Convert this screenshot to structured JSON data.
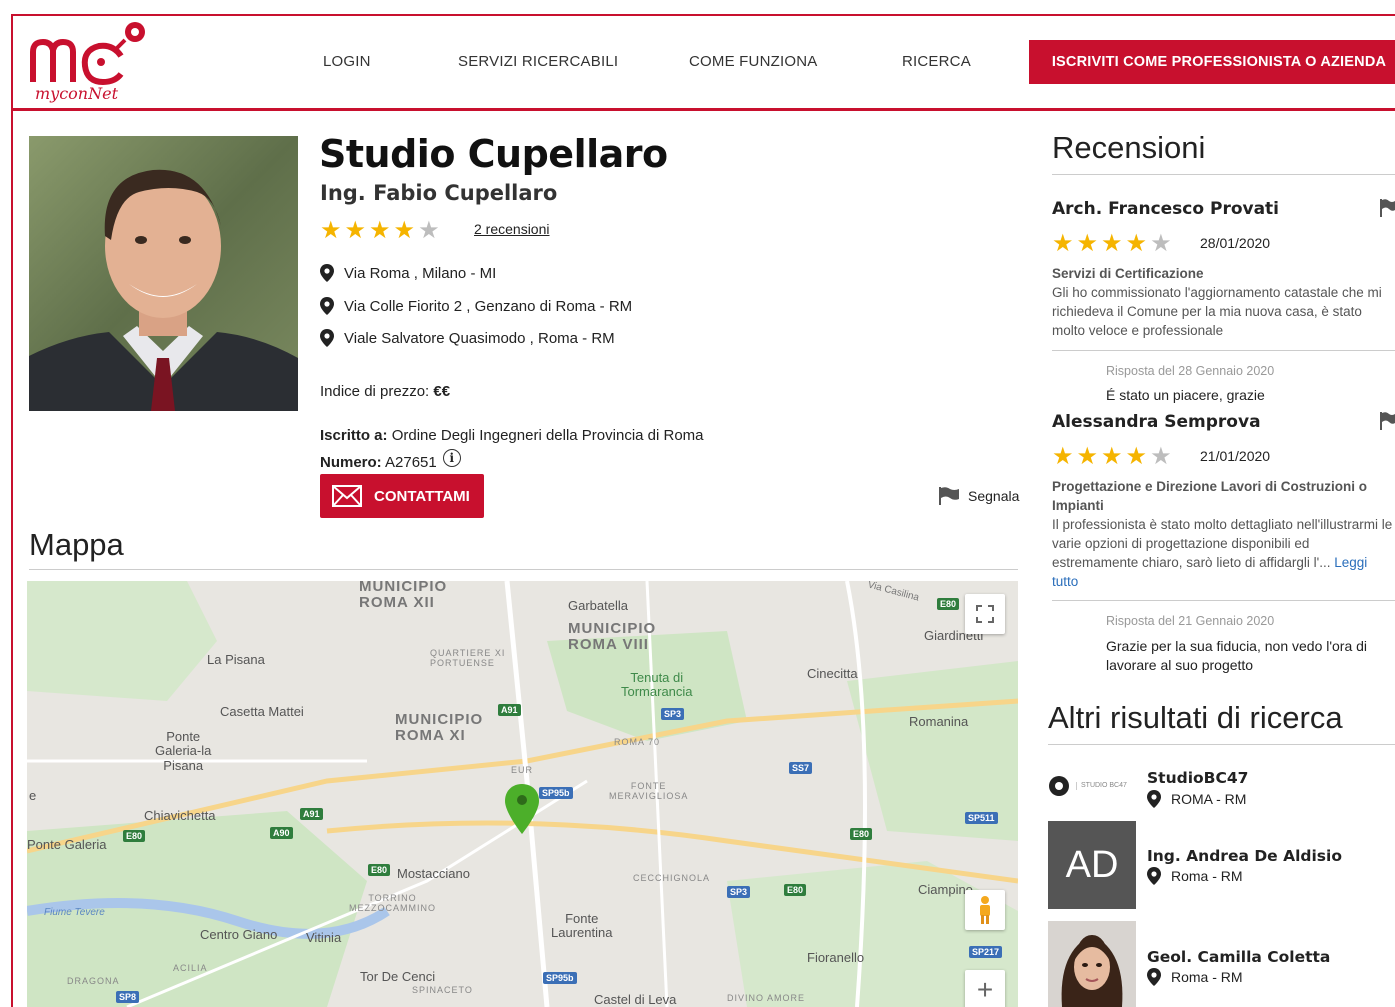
{
  "brand": {
    "name": "myconNet"
  },
  "nav": {
    "items": [
      "LOGIN",
      "SERVIZI RICERCABILI",
      "COME FUNZIONA",
      "RICERCA"
    ],
    "cta": "ISCRIVITI COME PROFESSIONISTA O AZIENDA"
  },
  "profile": {
    "studio": "Studio Cupellaro",
    "name": "Ing. Fabio Cupellaro",
    "rating": 4,
    "rating_max": 5,
    "reviews_link": "2 recensioni",
    "addresses": [
      "Via Roma , Milano - MI",
      "Via Colle Fiorito 2 , Genzano di Roma - RM",
      "Viale Salvatore Quasimodo , Roma - RM"
    ],
    "price_label": "Indice di prezzo:",
    "price_value": "€€",
    "iscritto_label": "Iscritto a:",
    "iscritto_value": "Ordine Degli Ingegneri della Provincia di Roma",
    "numero_label": "Numero:",
    "numero_value": "A27651",
    "contact_button": "CONTATTAMI",
    "report_label": "Segnala"
  },
  "map": {
    "title": "Mappa",
    "labels": {
      "municipio_xii": "MUNICIPIO\nROMA XII",
      "municipio_viii": "MUNICIPIO\nROMA VIII",
      "municipio_xi": "MUNICIPIO\nROMA XI",
      "garbatella": "Garbatella",
      "la_pisana": "La Pisana",
      "quartiere": "QUARTIERE XI\nPORTUENSE",
      "tenuta": "Tenuta di\nTormarancia",
      "cinecitta": "Cinecitta",
      "giardinetti": "Giardinetti",
      "casetta": "Casetta Mattei",
      "romanina": "Romanina",
      "ponte_galeria_pisana": "Ponte\nGaleria-la\nPisana",
      "roma70": "ROMA 70",
      "eur": "EUR",
      "fonte_meraviglio": "FONTE\nMERAVIGLIOSA",
      "chiavichetta": "Chiavichetta",
      "ponte_galeria": "Ponte Galeria",
      "mostacciano": "Mostacciano",
      "cecchignola": "CECCHIGNOLA",
      "ciampino": "Ciampino",
      "torrino": "TORRINO\nMEZZOCAMMINO",
      "fonte_laurentina": "Fonte\nLaurentina",
      "fiume": "Fiume Tevere",
      "centro_giano": "Centro Giano",
      "vitinia": "Vitinia",
      "acilia": "ACILIA",
      "dragona": "DRAGONA",
      "tor_de_cenci": "Tor De Cenci",
      "spinaceto": "SPINACETO",
      "fioranello": "Fioranello",
      "castel_di_leva": "Castel di Leva",
      "divino_amore": "DIVINO AMORE",
      "via_casilina": "Via Casilina",
      "e_edge": "e"
    },
    "badges": [
      "E80",
      "A91",
      "SP3",
      "SP95b",
      "SS7",
      "SP511",
      "E80",
      "A91",
      "A90",
      "E80",
      "E80",
      "SP3",
      "E80",
      "SP217",
      "SP95b",
      "SP8"
    ]
  },
  "reviews": {
    "title": "Recensioni",
    "items": [
      {
        "author": "Arch. Francesco Provati",
        "rating": 4,
        "date": "28/01/2020",
        "service": "Servizi di Certificazione",
        "text": "Gli ho commissionato l'aggiornamento catastale che mi richiedeva il Comune per la mia nuova casa, è stato molto veloce e professionale",
        "reply_date": "Risposta del 28 Gennaio 2020",
        "reply": "É stato un piacere, grazie"
      },
      {
        "author": "Alessandra Semprova",
        "rating": 4,
        "date": "21/01/2020",
        "service": "Progettazione e Direzione Lavori di Costruzioni o Impianti",
        "text": "Il professionista è stato molto dettagliato nell'illustrarmi le varie opzioni di progettazione disponibili ed estremamente chiaro, sarò lieto di affidargli l'...",
        "read_more": "Leggi tutto",
        "reply_date": "Risposta del 21 Gennaio 2020",
        "reply": "Grazie per la sua fiducia, non vedo l'ora di lavorare al suo progetto"
      }
    ]
  },
  "other_results": {
    "title": "Altri risultati di ricerca",
    "items": [
      {
        "name": "StudioBC47",
        "location": "ROMA - RM",
        "thumb_text": "STUDIO BC47"
      },
      {
        "name": "Ing. Andrea De Aldisio",
        "location": "Roma - RM",
        "thumb_text": "AD"
      },
      {
        "name": "Geol. Camilla Coletta",
        "location": "Roma - RM"
      }
    ]
  },
  "colors": {
    "brand_red": "#c8102e",
    "star": "#f5b400",
    "link_blue": "#2a6ebb"
  }
}
